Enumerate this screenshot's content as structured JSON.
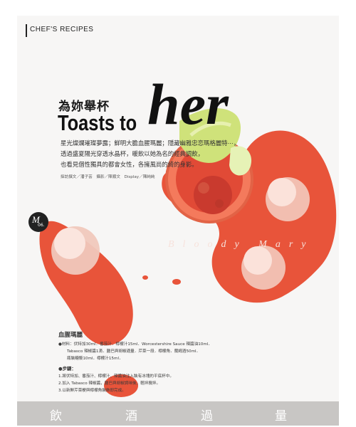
{
  "header": {
    "section": "CHEF'S RECIPES"
  },
  "title": {
    "chinese": "為妳舉杯",
    "english": "Toasts to",
    "english_script": "her"
  },
  "intro": {
    "lines": [
      "星光燦爛璀璨夢露；鮮明大膽血腥瑪麗；隱藏幽雅忠恋瑪格麗特⋯，",
      "透過盛夏陽光穿透水晶杯，暖飲以她為名的經典調飲，",
      "也看見個性獨具的都會女性，各擁風尚的綺的身影。"
    ],
    "credits": "採訪撰文／潘子芸　攝影／陳順文　Display／陳純純"
  },
  "page_badge": {
    "mark": "M",
    "number": "06."
  },
  "drink_name": "Bloody Mary",
  "recipe": {
    "title": "血腥瑪麗",
    "ingredients_label": "●材料：",
    "ingredient_lines": [
      "●材料：伏特加30ml．番茄汁．檸檬汁15ml．Worcestershire Sauce 辣醬油10ml．",
      "Tabasco 辣椒醬1滴．鹽巴與胡椒適量．芹菜一段．檸檬角．蘭姆酒50ml．",
      "瓶裝糖漿10ml．檸檬汁15ml．"
    ],
    "steps_title": "●步驟：",
    "steps": [
      "1.將伏特加、番茄汁、檸檬汁、辣醬油注入裝有冰塊的平底杯中。",
      "2.加入 Tabasco 辣椒醬，鹽巴與胡椒調味後，輕拌攪拌。",
      "3.以新鮮芹菜梗與檸檬角裝飾即完成。"
    ]
  },
  "footer": {
    "chars": [
      "飲",
      "酒",
      "過",
      "量"
    ]
  },
  "colors": {
    "sauce": "#e8543a",
    "sauce_light": "#f0703e",
    "footer_band": "#c8c6c4",
    "page_bg": "#f7f6f5"
  }
}
